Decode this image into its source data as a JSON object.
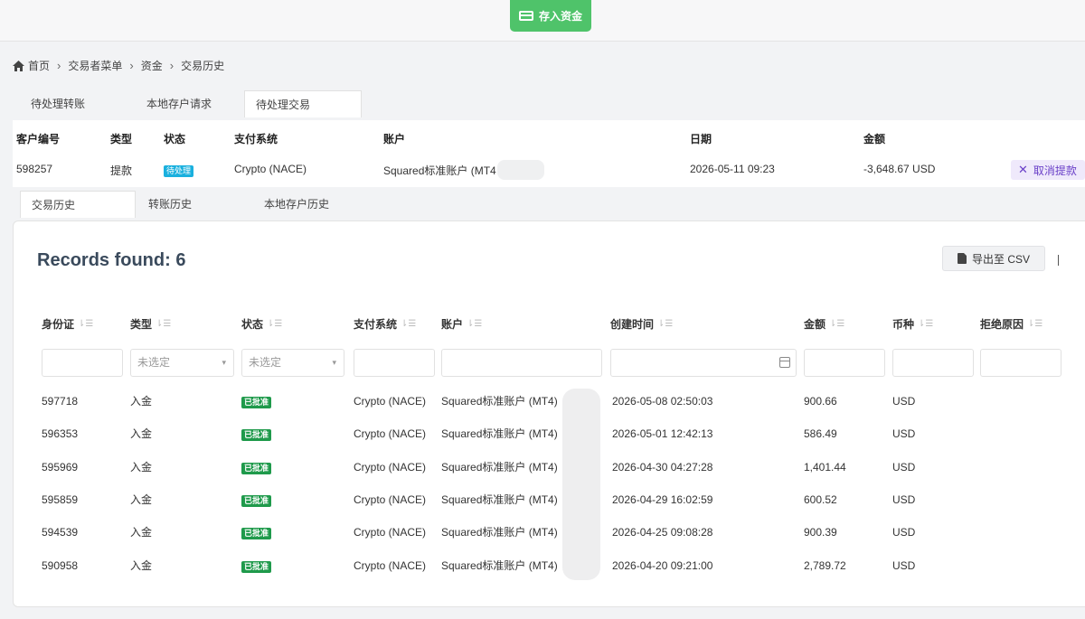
{
  "header": {
    "deposit_label": "存入资金"
  },
  "breadcrumb": [
    "首页",
    "交易者菜单",
    "资金",
    "交易历史"
  ],
  "top_tabs": [
    "待处理转账",
    "本地存户请求",
    "待处理交易"
  ],
  "pending": {
    "headers": [
      "客户编号",
      "类型",
      "状态",
      "支付系统",
      "账户",
      "日期",
      "金额"
    ],
    "row": {
      "client_id": "598257",
      "type": "提款",
      "status": "待处理",
      "payment": "Crypto (NACE)",
      "account": "Squared标准账户 (MT4",
      "date": "2026-05-11 09:23",
      "amount": "-3,648.67 USD",
      "action": "取消提款"
    }
  },
  "mid_tabs": [
    "交易历史",
    "转账历史",
    "本地存户历史"
  ],
  "history": {
    "records_label": "Records found: 6",
    "export_label": "导出至 CSV",
    "columns": [
      "身份证",
      "类型",
      "状态",
      "支付系统",
      "账户",
      "创建时间",
      "金额",
      "币种",
      "拒绝原因"
    ],
    "filters": {
      "type_placeholder": "未选定",
      "status_placeholder": "未选定"
    },
    "rows": [
      {
        "id": "597718",
        "type": "入金",
        "status": "已批准",
        "payment": "Crypto (NACE)",
        "account": "Squared标准账户 (MT4)",
        "created": "2026-05-08 02:50:03",
        "amount": "900.66",
        "currency": "USD"
      },
      {
        "id": "596353",
        "type": "入金",
        "status": "已批准",
        "payment": "Crypto (NACE)",
        "account": "Squared标准账户 (MT4)",
        "created": "2026-05-01 12:42:13",
        "amount": "586.49",
        "currency": "USD"
      },
      {
        "id": "595969",
        "type": "入金",
        "status": "已批准",
        "payment": "Crypto (NACE)",
        "account": "Squared标准账户 (MT4)",
        "created": "2026-04-30 04:27:28",
        "amount": "1,401.44",
        "currency": "USD"
      },
      {
        "id": "595859",
        "type": "入金",
        "status": "已批准",
        "payment": "Crypto (NACE)",
        "account": "Squared标准账户 (MT4)",
        "created": "2026-04-29 16:02:59",
        "amount": "600.52",
        "currency": "USD"
      },
      {
        "id": "594539",
        "type": "入金",
        "status": "已批准",
        "payment": "Crypto (NACE)",
        "account": "Squared标准账户 (MT4)",
        "created": "2026-04-25 09:08:28",
        "amount": "900.39",
        "currency": "USD"
      },
      {
        "id": "590958",
        "type": "入金",
        "status": "已批准",
        "payment": "Crypto (NACE)",
        "account": "Squared标准账户 (MT4)",
        "created": "2026-04-20 09:21:00",
        "amount": "2,789.72",
        "currency": "USD"
      }
    ]
  }
}
